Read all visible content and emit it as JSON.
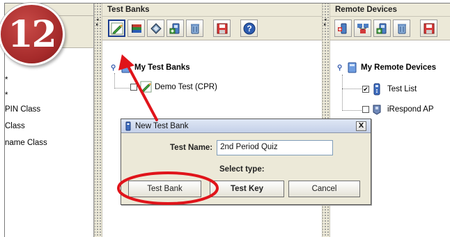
{
  "step_badge": "12",
  "left_panel": {
    "items": [
      "*",
      "*",
      "PIN Class",
      "Class",
      "name Class"
    ]
  },
  "middle_panel": {
    "title": "Test Banks",
    "toolbar_icons": [
      "new-test-bank-icon",
      "books-icon",
      "edit-icon",
      "add-device-icon",
      "delete-icon",
      "save-icon",
      "help-icon"
    ],
    "tree": {
      "root_label": "My Test Banks",
      "children": [
        {
          "label": "Demo Test (CPR)",
          "checked": false
        }
      ]
    }
  },
  "right_panel": {
    "title": "Remote Devices",
    "toolbar_icons": [
      "add-icon",
      "network-icon",
      "add-device-icon",
      "delete-icon",
      "save-icon"
    ],
    "tree": {
      "root_label": "My Remote Devices",
      "children": [
        {
          "label": "Test List",
          "checked": true
        },
        {
          "label": "iRespond AP",
          "checked": false
        }
      ]
    }
  },
  "dialog": {
    "title": "New Test Bank",
    "test_name_label": "Test Name:",
    "test_name_value": "2nd Period Quiz",
    "select_type_label": "Select type:",
    "buttons": {
      "test_bank": "Test Bank",
      "test_key": "Test Key",
      "cancel": "Cancel"
    },
    "close_label": "X"
  },
  "colors": {
    "annotation_red": "#e0141a",
    "badge_red": "#a52a2a",
    "panel_bg": "#ece9d8",
    "pressed_border": "#1b3d8f"
  }
}
